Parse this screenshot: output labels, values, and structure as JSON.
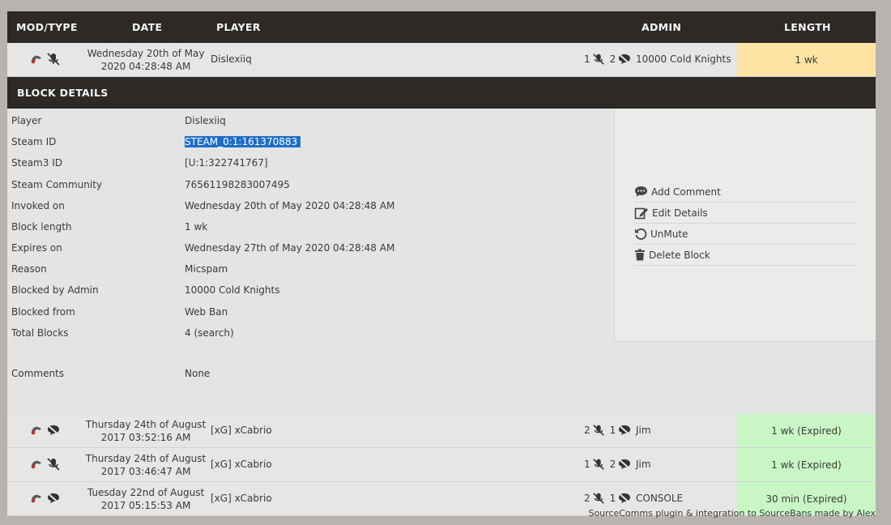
{
  "header": {
    "mod_type": "MOD/TYPE",
    "date": "DATE",
    "player": "PLAYER",
    "admin": "ADMIN",
    "length": "LENGTH"
  },
  "top_row": {
    "date": "Wednesday 20th of May 2020 04:28:48 AM",
    "player": "Dislexiiq",
    "count_a": "1",
    "count_b": "2",
    "admin": "10000 Cold Knights",
    "length": "1 wk"
  },
  "block_details": {
    "title": "BLOCK DETAILS",
    "fields": [
      {
        "label": "Player",
        "value": "Dislexiiq"
      },
      {
        "label": "Steam ID",
        "value": "STEAM_0:1:161370883"
      },
      {
        "label": "Steam3 ID",
        "value": "[U:1:322741767]"
      },
      {
        "label": "Steam Community",
        "value": "76561198283007495"
      },
      {
        "label": "Invoked on",
        "value": "Wednesday 20th of May 2020 04:28:48 AM"
      },
      {
        "label": "Block length",
        "value": "1 wk"
      },
      {
        "label": "Expires on",
        "value": "Wednesday 27th of May 2020 04:28:48 AM"
      },
      {
        "label": "Reason",
        "value": "Micspam"
      },
      {
        "label": "Blocked by Admin",
        "value": "10000 Cold Knights"
      },
      {
        "label": "Blocked from",
        "value": "Web Ban"
      },
      {
        "label": "Total Blocks",
        "value": "4 (search)"
      },
      {
        "label": "Comments",
        "value": "None"
      }
    ],
    "actions": [
      {
        "label": "Add Comment",
        "icon": "comment-icon"
      },
      {
        "label": "Edit Details",
        "icon": "edit-icon"
      },
      {
        "label": "UnMute",
        "icon": "undo-icon"
      },
      {
        "label": "Delete Block",
        "icon": "trash-icon"
      }
    ]
  },
  "rows": [
    {
      "date": "Thursday 24th of August 2017 03:52:16 AM",
      "player": "[xG] xCabrio",
      "count_a": "2",
      "count_b": "1",
      "admin": "Jim",
      "length": "1 wk (Expired)"
    },
    {
      "date": "Thursday 24th of August 2017 03:46:47 AM",
      "player": "[xG] xCabrio",
      "count_a": "1",
      "count_b": "2",
      "admin": "Jim",
      "length": "1 wk (Expired)"
    },
    {
      "date": "Tuesday 22nd of August 2017 05:15:53 AM",
      "player": "[xG] xCabrio",
      "count_a": "2",
      "count_b": "1",
      "admin": "CONSOLE",
      "length": "30 min (Expired)"
    }
  ],
  "footer": "SourceComms plugin & integration to SourceBans made by Alex",
  "colors": {
    "header_bg": "#2c2926",
    "active_length": "#fde3a4",
    "expired_length": "#c9f6c5",
    "selection": "#1e6ec8"
  }
}
